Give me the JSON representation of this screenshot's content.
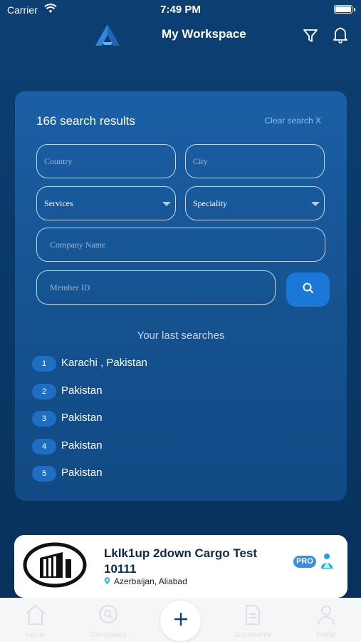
{
  "status_bar": {
    "carrier": "Carrier",
    "time": "7:49 PM"
  },
  "header": {
    "title": "My Workspace",
    "icons": [
      "app-logo-icon",
      "filter-icon",
      "bell-icon"
    ]
  },
  "search": {
    "results_count": "166 search results",
    "clear_label": "Clear search X",
    "country_placeholder": "Country",
    "city_placeholder": "City",
    "services_label": "Services",
    "speciality_label": "Speciality",
    "company_placeholder": "Company Name",
    "member_placeholder": "Member ID"
  },
  "last_searches": {
    "title": "Your last searches",
    "items": [
      {
        "index": "1",
        "label": "Karachi , Pakistan"
      },
      {
        "index": "2",
        "label": "Pakistan"
      },
      {
        "index": "3",
        "label": "Pakistan"
      },
      {
        "index": "4",
        "label": "Pakistan"
      },
      {
        "index": "5",
        "label": "Pakistan"
      }
    ]
  },
  "company_card": {
    "name": "Lklk1up 2down Cargo Test 10111",
    "location": "Azerbaijan, Aliabad",
    "badge": "PRO"
  },
  "tab_bar": {
    "tabs": [
      {
        "label": "Home",
        "icon": "home-icon"
      },
      {
        "label": "Companies",
        "icon": "companies-icon"
      },
      {
        "label": "Documents",
        "icon": "documents-icon"
      },
      {
        "label": "Profile",
        "icon": "profile-icon"
      }
    ],
    "add_icon": "plus-icon"
  },
  "colors": {
    "background": "#0c3f72",
    "panel": "#1b5fa6",
    "accent": "#1a78d6",
    "link": "#7fc3ff",
    "card_text": "#0c2a4a"
  }
}
